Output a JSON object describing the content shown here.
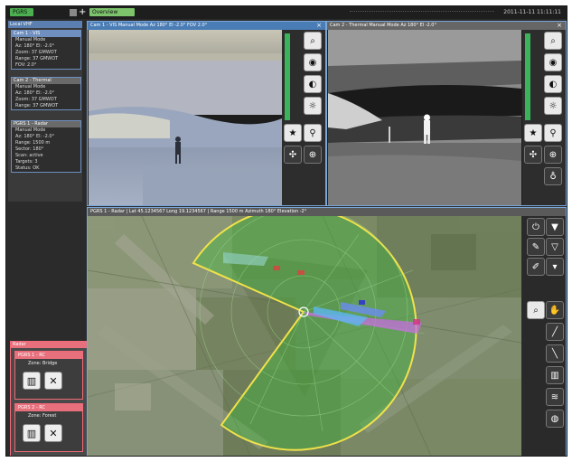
{
  "topbar": {
    "home": "PGRS",
    "mode": "Overview",
    "time": "2011-11-11 11:11:11"
  },
  "left_panel": {
    "header": "Local VHF",
    "cards": [
      {
        "title": "Cam 1 - VIS",
        "lines": [
          "Manual Mode",
          "Az: 180°  El: -2.0°",
          "Zoom: 37 GMWOT",
          "Range: 37 GMWOT",
          "FOV: 2.0°"
        ]
      },
      {
        "title": "Cam 2 - Thermal",
        "lines": [
          "Manual Mode",
          "Az: 180°  El: -2.0°",
          "Zoom: 37 GMWOT",
          "Range: 37 GMWOT"
        ]
      },
      {
        "title": "PGRS 1 - Radar",
        "lines": [
          "Manual Mode",
          "Az: 180°  El: -2.0°",
          "Range: 1500 m",
          "Sector: 180°",
          "Scan: active",
          "Targets: 3",
          "Status: OK"
        ]
      }
    ]
  },
  "cam1": {
    "title": "Cam 1 - VIS   Manual Mode   Az 180°   El -2.0°   FOV 2.0°",
    "icons": [
      "zoom-icon",
      "binoculars-icon",
      "contrast-icon",
      "brightness-icon",
      "star-icon",
      "link-icon",
      "move-icon",
      "crosshair-icon"
    ]
  },
  "cam2": {
    "title": "Cam 2 - Thermal   Manual Mode   Az 180°   El -2.0°",
    "icons": [
      "zoom-icon",
      "binoculars-icon",
      "contrast-icon",
      "brightness-icon",
      "star-icon",
      "link-icon",
      "move-icon",
      "target-icon",
      "bulb-icon"
    ]
  },
  "map": {
    "title": "PGRS 1 - Radar   |   Lat 45.1234567   Long 19.1234567   |   Range 1500 m   Azimuth 180°   Elevation -2°"
  },
  "control_panel": {
    "header": "Radar",
    "boxes": [
      {
        "title": "PGRS 1 - RC",
        "line": "Zone: Bridge"
      },
      {
        "title": "PGRS 2 - RC",
        "line": "Zone: Forest"
      }
    ]
  },
  "colors": {
    "sector_outline": "#f0e24a",
    "accent_blue": "#4a7db6",
    "alert_pink": "#e8707c"
  }
}
